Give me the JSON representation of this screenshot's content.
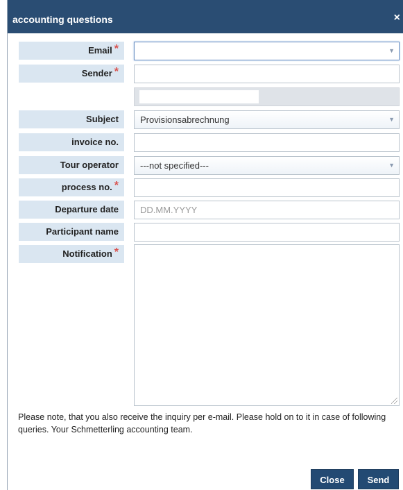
{
  "dialog": {
    "title": "accounting questions",
    "close_symbol": "×"
  },
  "form": {
    "required_marker": "*",
    "email": {
      "label": "Email",
      "value": ""
    },
    "sender": {
      "label": "Sender",
      "value": ""
    },
    "subject": {
      "label": "Subject",
      "value": "Provisionsabrechnung"
    },
    "invoice_no": {
      "label": "invoice no.",
      "value": ""
    },
    "tour_operator": {
      "label": "Tour operator",
      "value": "---not specified---"
    },
    "process_no": {
      "label": "process no.",
      "value": ""
    },
    "departure_date": {
      "label": "Departure date",
      "placeholder": "DD.MM.YYYY"
    },
    "participant_name": {
      "label": "Participant name",
      "value": ""
    },
    "notification": {
      "label": "Notification",
      "value": ""
    }
  },
  "note": "Please note, that you also receive the inquiry per e-mail. Please hold on to it in case of following queries. Your Schmetterling accounting team.",
  "buttons": {
    "close": "Close",
    "send": "Send"
  },
  "colors": {
    "titlebar": "#2a4d73",
    "label_bg": "#dae6f1",
    "required": "#d9534f",
    "button": "#234a73"
  }
}
